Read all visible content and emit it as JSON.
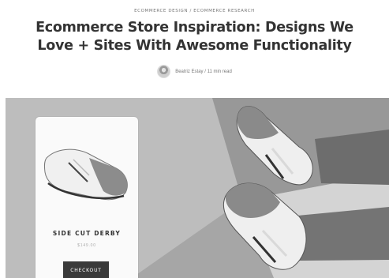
{
  "article": {
    "category_1": "ECOMMERCE DESIGN",
    "category_separator": " / ",
    "category_2": "ECOMMERCE RESEARCH",
    "title_line_1": "Ecommerce Store Inspiration: Designs We",
    "title_line_2": "Love + Sites With Awesome Functionality",
    "author": "Beatriz Estay",
    "byline_separator": " / ",
    "read_time": "11 min read"
  },
  "product_card": {
    "name": "SIDE CUT DERBY",
    "price": "$149.00",
    "button_label": "CHECKOUT"
  },
  "colors": {
    "hero_background": "#bcbcbc",
    "button": "#3a3a3a",
    "card": "#fafafa"
  }
}
